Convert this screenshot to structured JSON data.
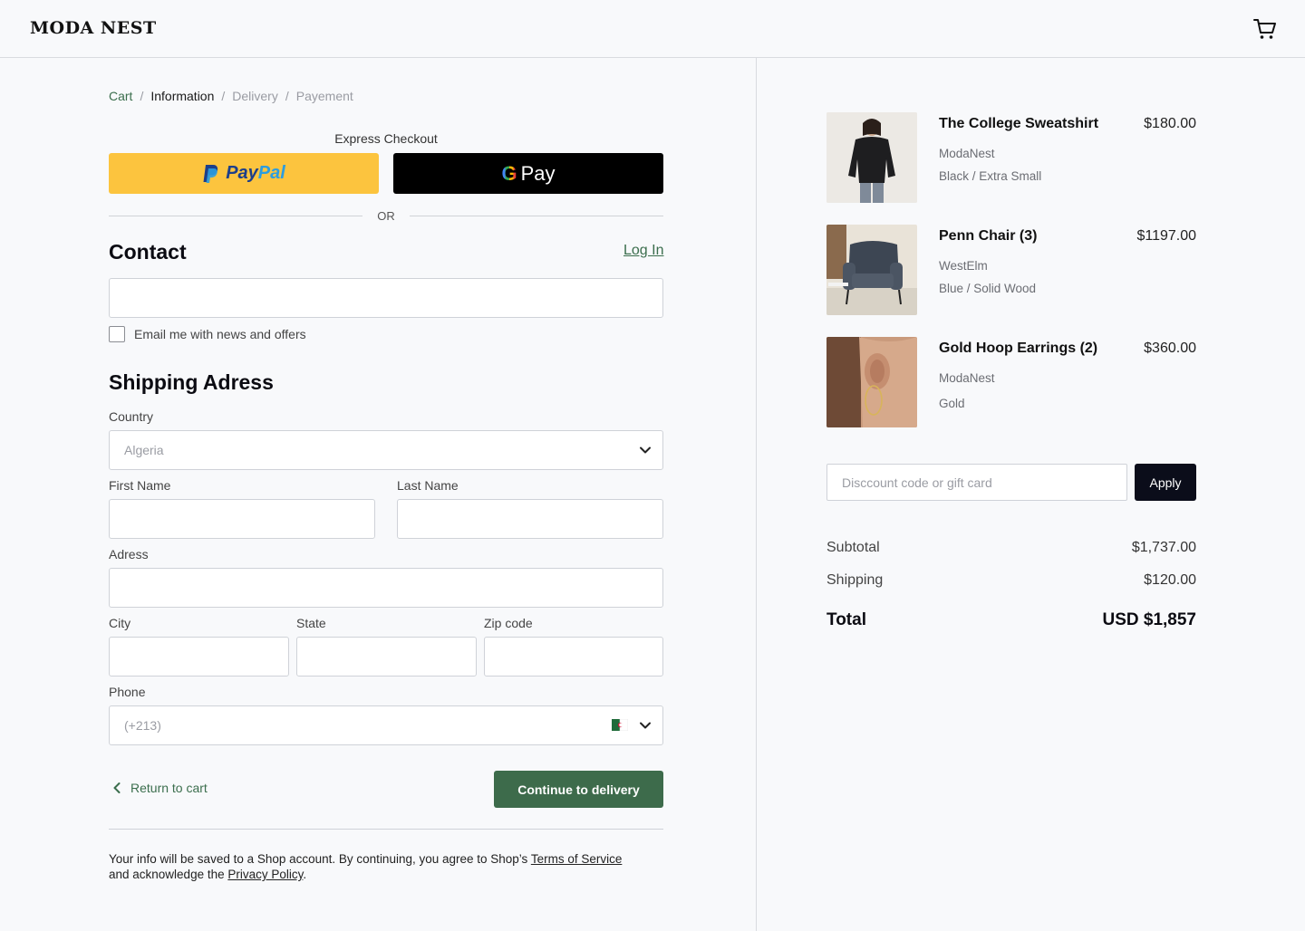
{
  "brand": {
    "logo": "MODA NEST"
  },
  "breadcrumb": {
    "cart": "Cart",
    "sep": "/",
    "information": "Information",
    "delivery": "Delivery",
    "payment": "Payement"
  },
  "express": {
    "label": "Express Checkout",
    "paypal_pay": "Pay",
    "paypal_pal": "Pal",
    "gpay_g": "G",
    "gpay_label": "Pay",
    "or": "OR"
  },
  "contact": {
    "title": "Contact",
    "login": "Log In",
    "email_value": "",
    "newsletter_label": "Email me with news and offers",
    "newsletter_checked": false
  },
  "shipping": {
    "title": "Shipping Adress",
    "country_label": "Country",
    "country_value": "Algeria",
    "first_name_label": "First Name",
    "last_name_label": "Last Name",
    "address_label": "Adress",
    "city_label": "City",
    "state_label": "State",
    "zip_label": "Zip code",
    "phone_label": "Phone",
    "phone_placeholder": "(+213)"
  },
  "actions": {
    "return": "Return to cart",
    "continue": "Continue to delivery"
  },
  "legal": {
    "text1": "Your info will be saved to a Shop account. By continuing, you agree to Shop’s ",
    "terms": "Terms of Service",
    "text2": "and acknowledge the ",
    "privacy": "Privacy Policy",
    "text3": "."
  },
  "order": {
    "items": [
      {
        "name": "The College Sweatshirt",
        "price": "$180.00",
        "brand": "ModaNest",
        "variant": "Black / Extra Small"
      },
      {
        "name": "Penn Chair (3)",
        "price": "$1197.00",
        "brand": "WestElm",
        "variant": "Blue / Solid Wood"
      },
      {
        "name": "Gold Hoop Earrings (2)",
        "price": "$360.00",
        "brand": "ModaNest",
        "variant": "Gold"
      }
    ],
    "discount_placeholder": "Disccount code or gift card",
    "apply": "Apply",
    "subtotal_label": "Subtotal",
    "subtotal": "$1,737.00",
    "shipping_label": "Shipping",
    "shipping": "$120.00",
    "total_label": "Total",
    "total": "USD $1,857"
  },
  "colors": {
    "accent": "#3d6b4b",
    "paypal": "#fcc43e",
    "dark": "#0b0d1a"
  }
}
